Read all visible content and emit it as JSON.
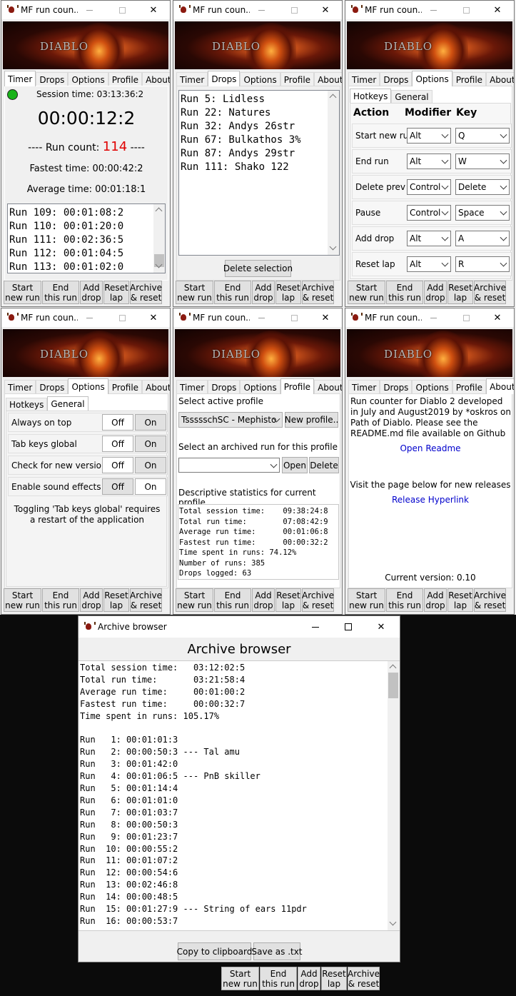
{
  "app": {
    "window_title": "MF run coun...",
    "banner_logo": "DIABLO",
    "tabs": [
      "Timer",
      "Drops",
      "Options",
      "Profile",
      "About"
    ],
    "bottom_buttons": [
      {
        "l1": "Start",
        "l2": "new run"
      },
      {
        "l1": "End",
        "l2": "this run"
      },
      {
        "l1": "Add",
        "l2": "drop"
      },
      {
        "l1": "Reset",
        "l2": "lap"
      },
      {
        "l1": "Archive",
        "l2": "& reset"
      }
    ]
  },
  "timer": {
    "status_color": "#19b319",
    "session_time": "Session time: 03:13:36:2",
    "big_timer": "00:00:12:2",
    "run_count_prefix": "---- Run count:",
    "run_count_value": "114",
    "run_count_suffix": "----",
    "run_count_color": "#e00000",
    "fastest": "Fastest time: 00:00:42:2",
    "average": "Average time: 00:01:18:1",
    "runs": [
      "Run 109: 00:01:08:2",
      "Run 110: 00:01:20:0",
      "Run 111: 00:02:36:5",
      "Run 112: 00:01:04:5",
      "Run 113: 00:01:02:0"
    ]
  },
  "drops": {
    "items": [
      "Run 5: Lidless",
      "Run 22: Natures",
      "Run 32: Andys 26str",
      "Run 67: Bulkathos 3%",
      "Run 87: Andys 29str",
      "Run 111: Shako 122"
    ],
    "delete_button": "Delete selection"
  },
  "options_hotkeys": {
    "subtabs": [
      "Hotkeys",
      "General"
    ],
    "headers": [
      "Action",
      "Modifier",
      "Key"
    ],
    "rows": [
      {
        "action": "Start new run",
        "modifier": "Alt",
        "key": "Q"
      },
      {
        "action": "End run",
        "modifier": "Alt",
        "key": "W"
      },
      {
        "action": "Delete prev",
        "modifier": "Control",
        "key": "Delete"
      },
      {
        "action": "Pause",
        "modifier": "Control",
        "key": "Space"
      },
      {
        "action": "Add drop",
        "modifier": "Alt",
        "key": "A"
      },
      {
        "action": "Reset lap",
        "modifier": "Alt",
        "key": "R"
      }
    ]
  },
  "options_general": {
    "off_label": "Off",
    "on_label": "On",
    "rows": [
      {
        "label": "Always on top",
        "selected": "Off"
      },
      {
        "label": "Tab keys global",
        "selected": "Off"
      },
      {
        "label": "Check for new version",
        "selected": "Off"
      },
      {
        "label": "Enable sound effects",
        "selected": "On"
      }
    ],
    "note": "Toggling 'Tab keys global' requires a restart of the application"
  },
  "profile": {
    "select_label": "Select active profile",
    "active_profile": "TssssschSC - Mephisto",
    "new_profile_button": "New profile..",
    "archived_label": "Select an archived run for this profile",
    "archived_value": "",
    "open_button": "Open",
    "delete_button": "Delete",
    "stats_label": "Descriptive statistics for current profile",
    "stats": [
      "Total session time:    09:38:24:8",
      "Total run time:        07:08:42:9",
      "Average run time:      00:01:06:8",
      "Fastest run time:      00:00:32:2",
      "Time spent in runs: 74.12%",
      "Number of runs: 385",
      "Drops logged: 63"
    ]
  },
  "about": {
    "description": "Run counter for Diablo 2 developed in July and August2019 by *oskros on Path of Diablo. Please see the README.md file available on Github",
    "readme_link": "Open Readme",
    "releases_text": "Visit the page below for new releases",
    "release_link": "Release Hyperlink",
    "version": "Current version: 0.10"
  },
  "archive": {
    "window_title": "Archive browser",
    "heading": "Archive browser",
    "lines": [
      "Total session time:   03:12:02:5",
      "Total run time:       03:21:58:4",
      "Average run time:     00:01:00:2",
      "Fastest run time:     00:00:32:7",
      "Time spent in runs: 105.17%",
      "",
      "Run   1: 00:01:01:3",
      "Run   2: 00:00:50:3 --- Tal amu",
      "Run   3: 00:01:42:0",
      "Run   4: 00:01:06:5 --- PnB skiller",
      "Run   5: 00:01:14:4",
      "Run   6: 00:01:01:0",
      "Run   7: 00:01:03:7",
      "Run   8: 00:00:50:3",
      "Run   9: 00:01:23:7",
      "Run  10: 00:00:55:2",
      "Run  11: 00:01:07:2",
      "Run  12: 00:00:54:6",
      "Run  13: 00:02:46:8",
      "Run  14: 00:00:48:5",
      "Run  15: 00:01:27:9 --- String of ears 11pdr",
      "Run  16: 00:00:53:7"
    ],
    "copy_button": "Copy to clipboard",
    "save_button": "Save as .txt"
  }
}
